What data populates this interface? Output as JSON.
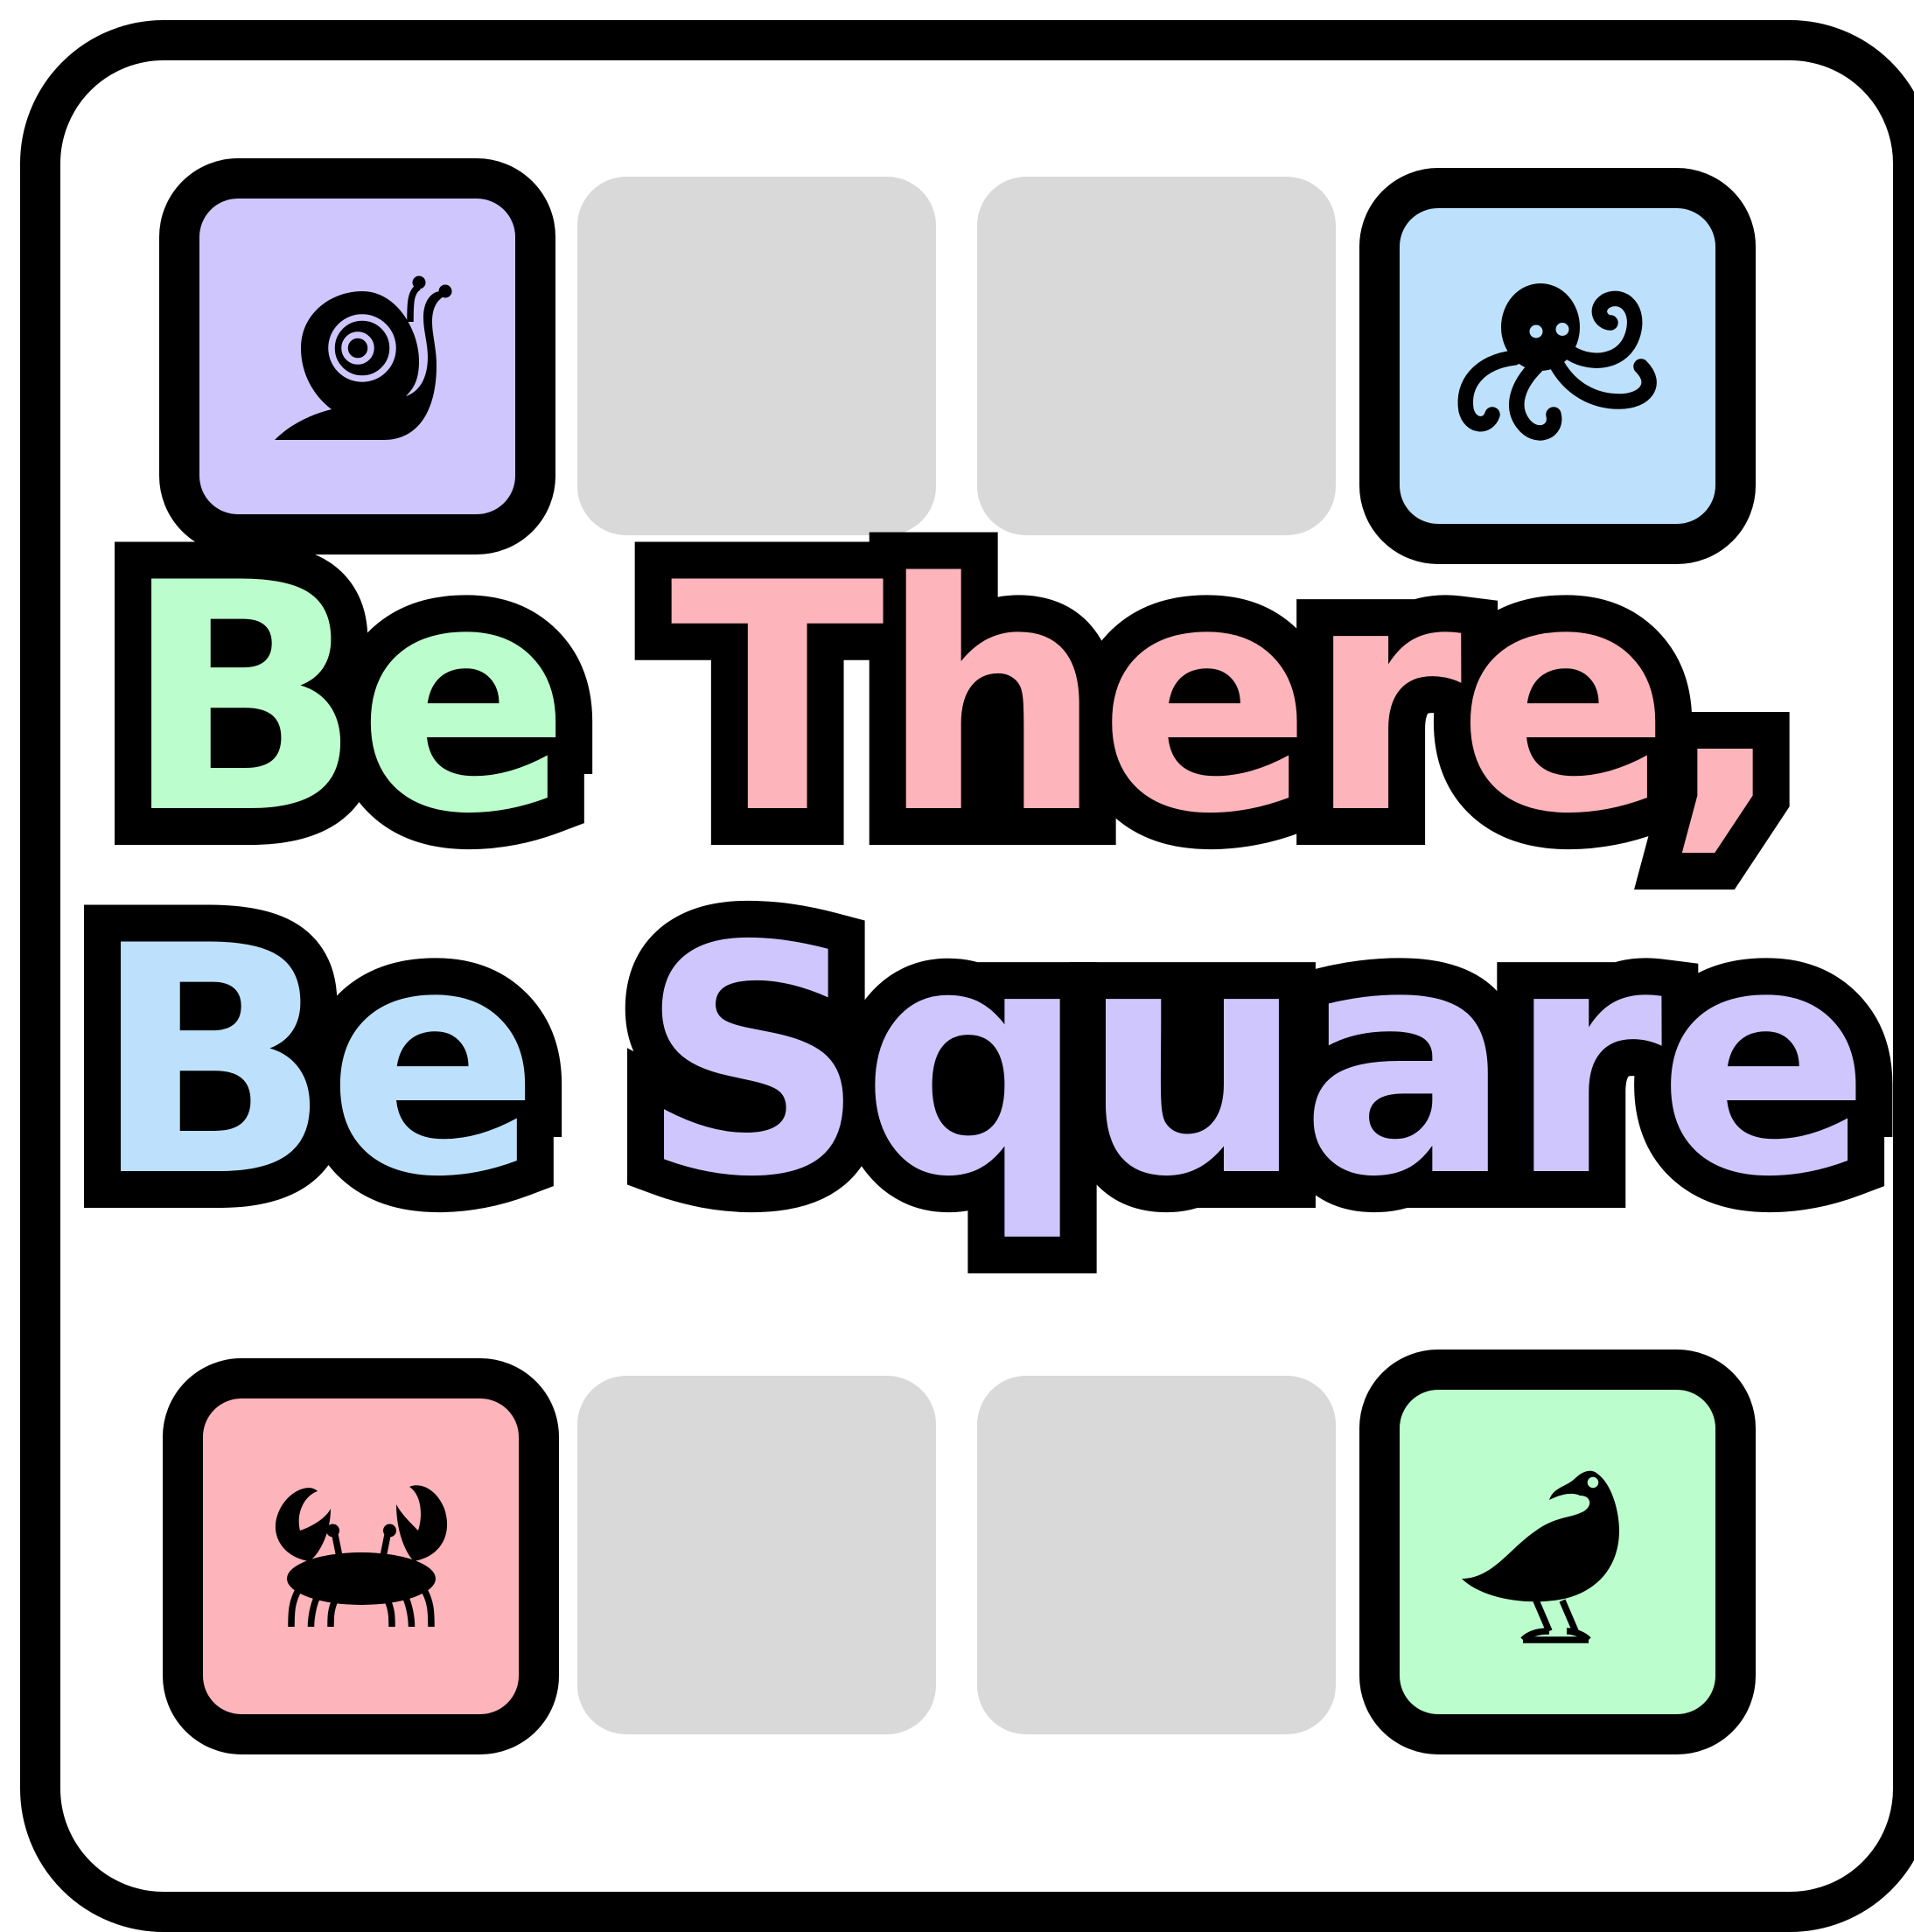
{
  "title": {
    "line1": [
      {
        "text": "Be",
        "color": "#bbfdcc"
      },
      {
        "text": " ",
        "color": "#ffffff"
      },
      {
        "text": "There,",
        "color": "#fdb4bb"
      }
    ],
    "line2": [
      {
        "text": "Be",
        "color": "#bde1fc"
      },
      {
        "text": " ",
        "color": "#ffffff"
      },
      {
        "text": "Square",
        "color": "#cfc6fe"
      }
    ]
  },
  "tiles": {
    "top_left": {
      "icon": "snail-icon",
      "color": "#cfc6fe"
    },
    "top_right": {
      "icon": "octopus-icon",
      "color": "#bde1fc"
    },
    "bottom_left": {
      "icon": "crab-icon",
      "color": "#fdb4bb"
    },
    "bottom_right": {
      "icon": "bird-icon",
      "color": "#bbfdcc"
    }
  },
  "empty_tile_color": "#d9d9d9"
}
